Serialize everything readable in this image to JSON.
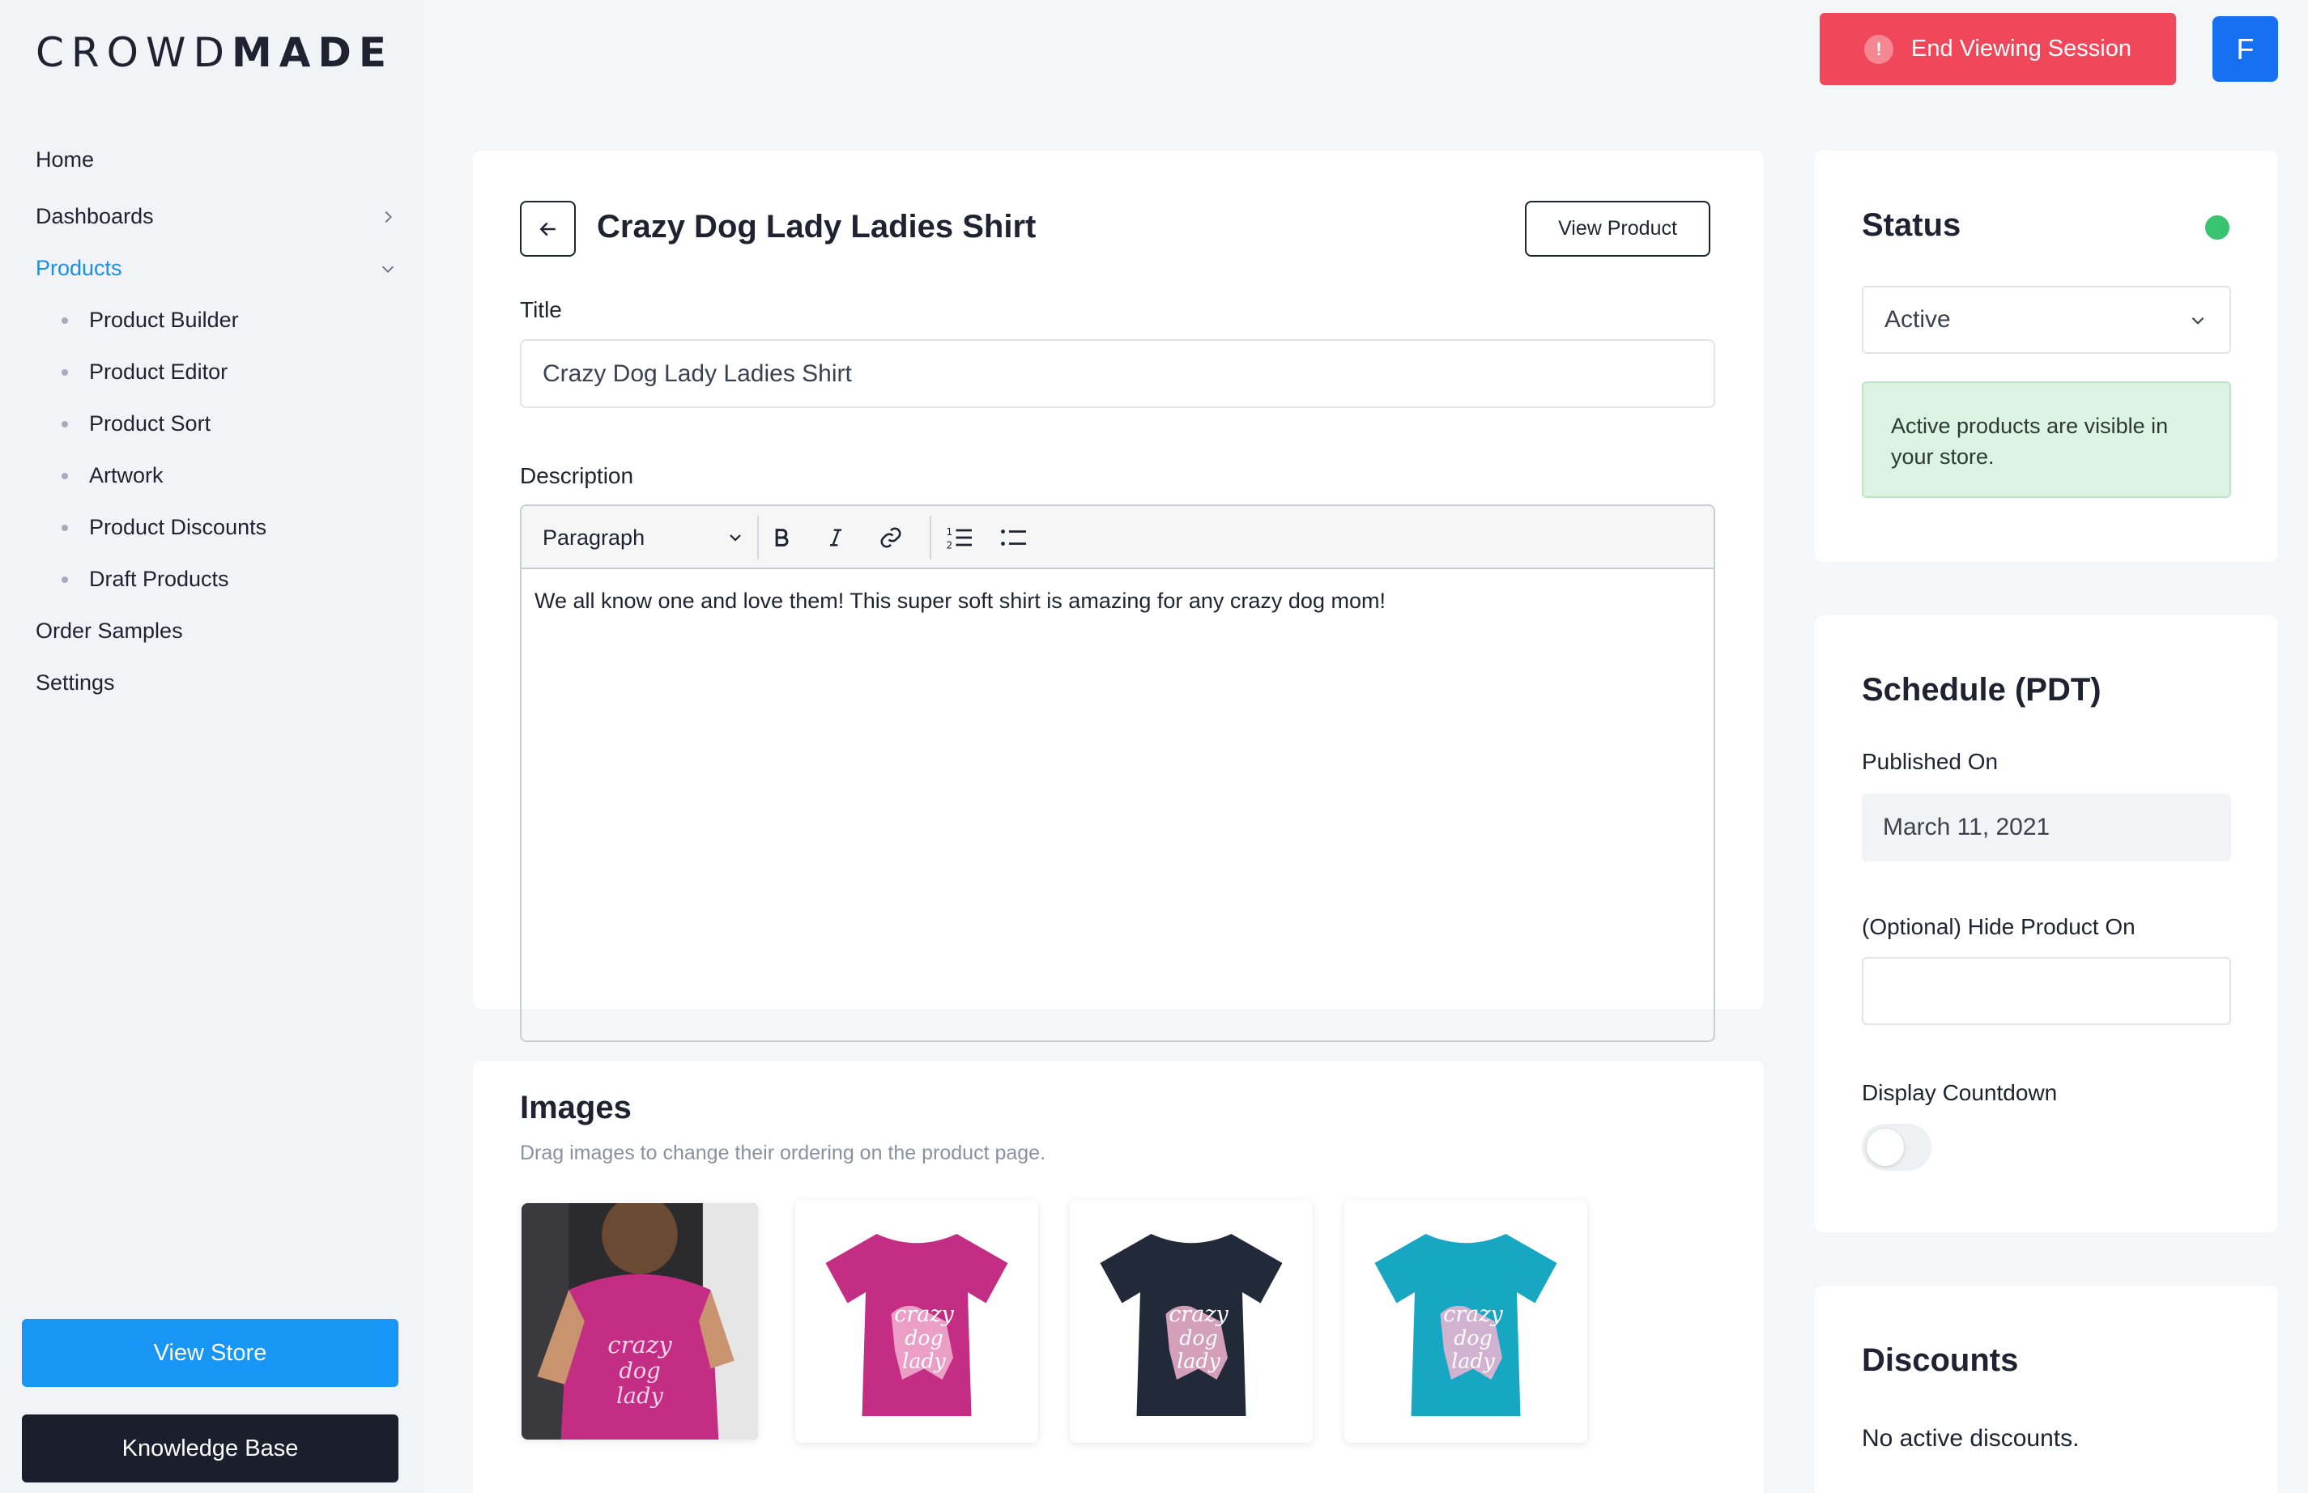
{
  "brand": {
    "logo_light": "CROWD",
    "logo_bold": "MADE"
  },
  "sidebar": {
    "nav": [
      {
        "label": "Home"
      },
      {
        "label": "Dashboards"
      },
      {
        "label": "Products"
      },
      {
        "label": "Order Samples"
      },
      {
        "label": "Settings"
      }
    ],
    "sub_items": [
      {
        "label": "Product Builder"
      },
      {
        "label": "Product Editor"
      },
      {
        "label": "Product Sort"
      },
      {
        "label": "Artwork"
      },
      {
        "label": "Product Discounts"
      },
      {
        "label": "Draft Products"
      }
    ],
    "view_store": "View Store",
    "knowledge_base": "Knowledge Base"
  },
  "topbar": {
    "end_session": "End Viewing Session",
    "avatar_initial": "F"
  },
  "product": {
    "page_title": "Crazy Dog Lady Ladies Shirt",
    "view_product": "View Product",
    "title_label": "Title",
    "title_value": "Crazy Dog Lady Ladies Shirt",
    "description_label": "Description",
    "format_select": "Paragraph",
    "description_text": "We all know one and love them! This super soft shirt is amazing for any crazy dog mom!"
  },
  "images": {
    "title": "Images",
    "hint": "Drag images to change their ordering on the product page.",
    "items": [
      {
        "name": "model-pink-shirt",
        "color": "#c42d84"
      },
      {
        "name": "pink-shirt",
        "color": "#c42d84"
      },
      {
        "name": "navy-shirt",
        "color": "#222a3a"
      },
      {
        "name": "teal-shirt",
        "color": "#18a7c2"
      }
    ],
    "shirt_print": [
      "crazy",
      "dog",
      "lady"
    ]
  },
  "status": {
    "title": "Status",
    "selected": "Active",
    "info": "Active products are visible in your store.",
    "dot_color": "#37c370"
  },
  "schedule": {
    "title": "Schedule (PDT)",
    "published_label": "Published On",
    "published_value": "March 11, 2021",
    "hide_label": "(Optional) Hide Product On",
    "countdown_label": "Display Countdown"
  },
  "discounts": {
    "title": "Discounts",
    "empty": "No active discounts."
  }
}
